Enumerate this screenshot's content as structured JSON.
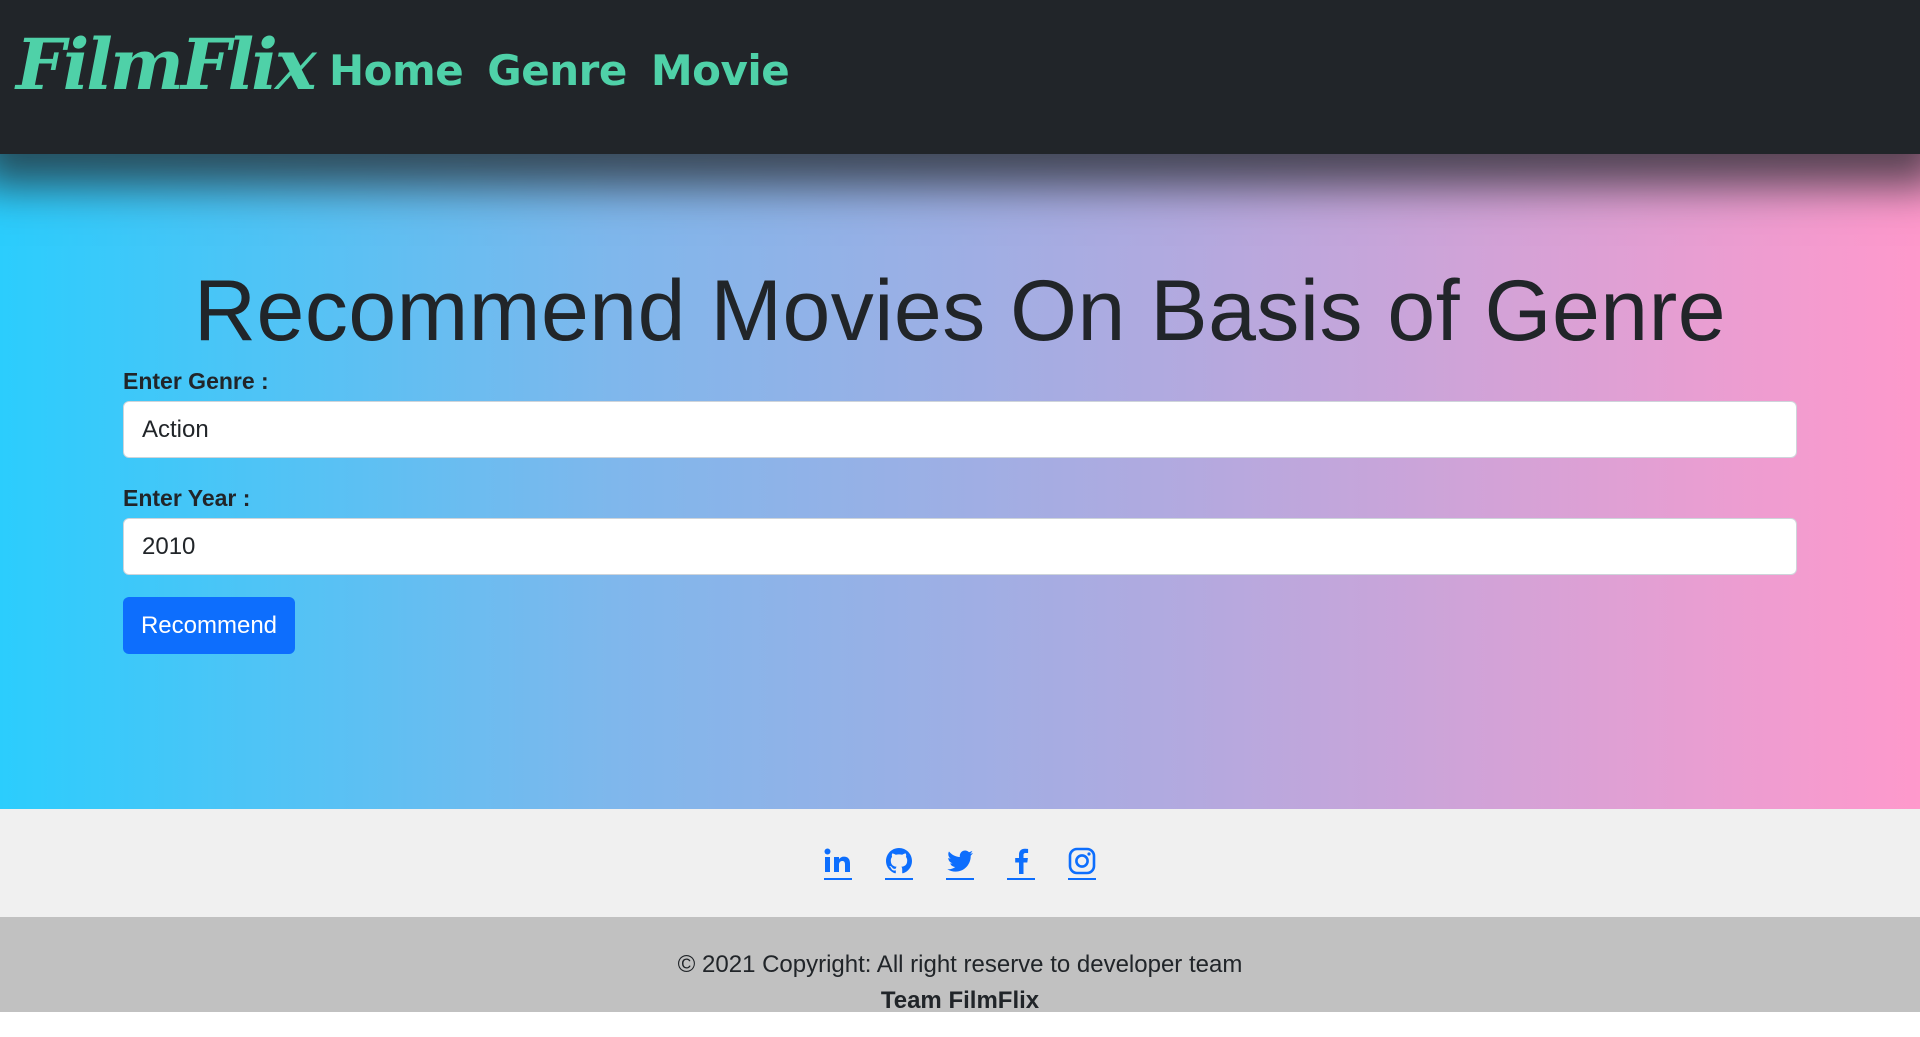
{
  "nav": {
    "brand": "FilmFlix",
    "links": [
      "Home",
      "Genre",
      "Movie"
    ]
  },
  "hero": {
    "title": "Recommend Movies On Basis of Genre",
    "genre_label": "Enter Genre :",
    "genre_value": "Action",
    "year_label": "Enter Year :",
    "year_value": "2010",
    "button_label": "Recommend"
  },
  "social": {
    "icons": [
      "linkedin-icon",
      "github-icon",
      "twitter-icon",
      "facebook-icon",
      "instagram-icon"
    ]
  },
  "footer": {
    "copyright": "© 2021 Copyright: All right reserve to developer team",
    "team": "Team FilmFlix"
  },
  "colors": {
    "navbar": "#212529",
    "brand_accent": "#4fd1a8",
    "button": "#0d6efd",
    "gradient_start": "#2bcdfd",
    "gradient_end": "#ff99cc",
    "social_bar": "#f0f0f0",
    "copyright_bar": "#c1c1c1"
  }
}
